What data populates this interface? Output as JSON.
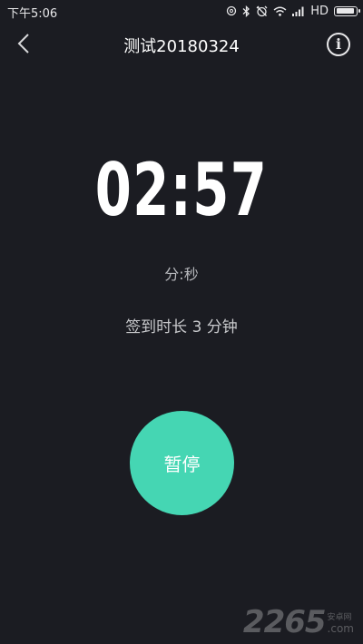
{
  "status_bar": {
    "time": "下午5:06",
    "network_label": "HD",
    "battery_level": 0.95,
    "icons": [
      "alarm-icon",
      "bluetooth-icon",
      "no-alarm-icon",
      "wifi-icon",
      "signal-icon",
      "battery-icon"
    ]
  },
  "nav": {
    "back_icon": "chevron-left-icon",
    "title": "测试20180324",
    "info_icon": "info-icon",
    "info_glyph": "i"
  },
  "timer": {
    "time": "02:57",
    "unit": "分:秒"
  },
  "sign": {
    "text": "签到时长 3 分钟"
  },
  "pause_button": {
    "label": "暂停"
  },
  "watermark": {
    "number": "2265",
    "cn": "安卓网",
    "com": ".com"
  },
  "colors": {
    "background": "#1b1c22",
    "accent": "#45d6b3",
    "text_primary": "#ffffff",
    "text_secondary": "#b8b9bd"
  }
}
